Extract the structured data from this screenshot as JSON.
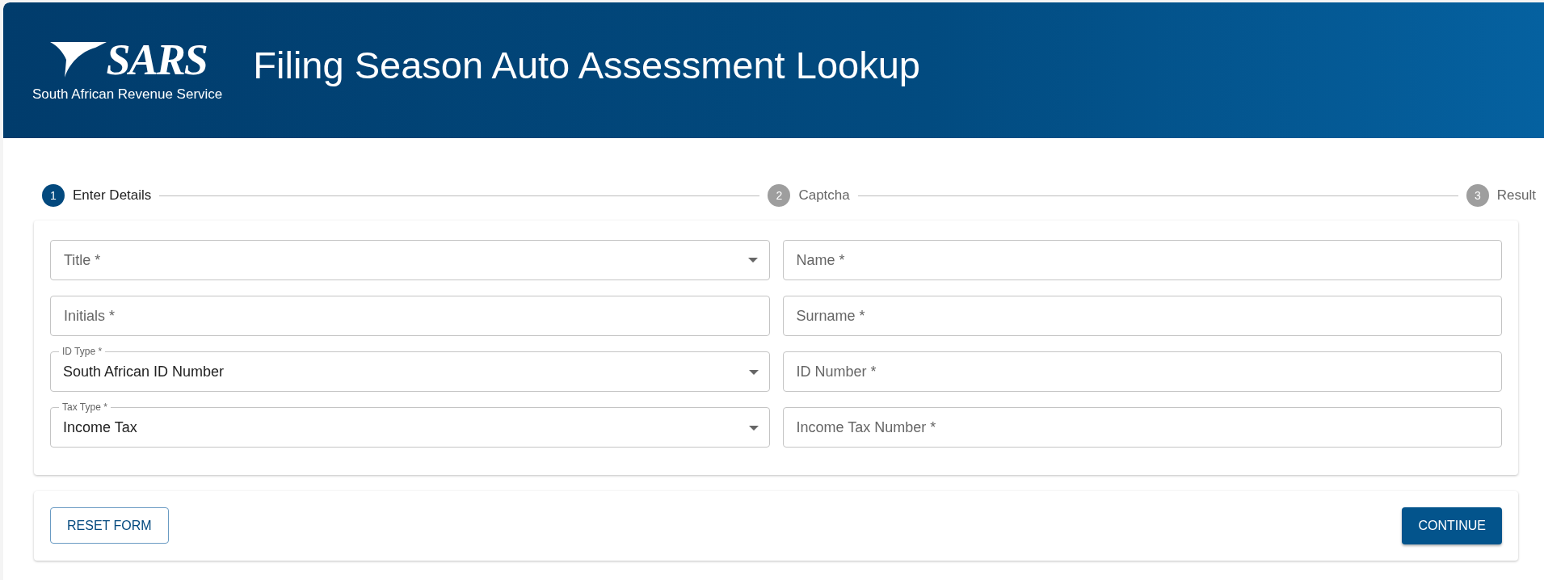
{
  "header": {
    "logo_text": "SARS",
    "logo_subtitle": "South African Revenue Service",
    "title": "Filing Season Auto Assessment Lookup"
  },
  "steps": [
    {
      "number": "1",
      "label": "Enter Details",
      "selected": true
    },
    {
      "number": "2",
      "label": "Captcha",
      "selected": false
    },
    {
      "number": "3",
      "label": "Result",
      "selected": false
    }
  ],
  "fields": [
    {
      "kind": "select",
      "label": "Title *"
    },
    {
      "kind": "text",
      "placeholder": "Name *"
    },
    {
      "kind": "text",
      "placeholder": "Initials *"
    },
    {
      "kind": "text",
      "placeholder": "Surname *"
    },
    {
      "kind": "select",
      "label": "ID Type *",
      "value": "South African ID Number"
    },
    {
      "kind": "text",
      "placeholder": "ID Number *"
    },
    {
      "kind": "select",
      "label": "Tax Type *",
      "value": "Income Tax"
    },
    {
      "kind": "text",
      "placeholder": "Income Tax Number *"
    }
  ],
  "buttons": {
    "reset": "RESET FORM",
    "continue": "CONTINUE"
  }
}
